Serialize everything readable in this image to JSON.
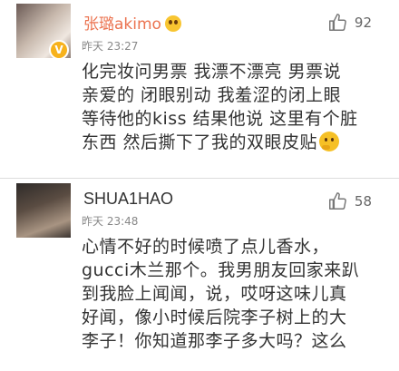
{
  "comments": [
    {
      "author": "张璐akimo",
      "time": "昨天 23:27",
      "likes": "92",
      "lines": [
        "化完妆问男票 我漂不漂亮 男票说",
        "亲爱的 闭眼别动 我羞涩的闭上眼",
        "等待他的kiss 结果他说 这里有个脏",
        "东西 然后撕下了我的双眼皮贴"
      ],
      "verified_badge": "V"
    },
    {
      "author": "SHUA1HAO",
      "time": "昨天 23:48",
      "likes": "58",
      "lines": [
        "心情不好的时候喷了点儿香水，",
        "gucci木兰那个。我男朋友回家来趴",
        "到我脸上闻闻，说，哎呀这味儿真",
        "好闻，像小时候后院李子树上的大",
        "李子！你知道那李子多大吗？这么"
      ]
    }
  ],
  "colors": {
    "vip_name": "#eb7350",
    "name": "#333333",
    "time": "#888888",
    "text": "#333333",
    "badge": "#f7b21c"
  },
  "icons": {
    "like": "thumbs-up-icon",
    "more": "chevron-down-icon"
  }
}
